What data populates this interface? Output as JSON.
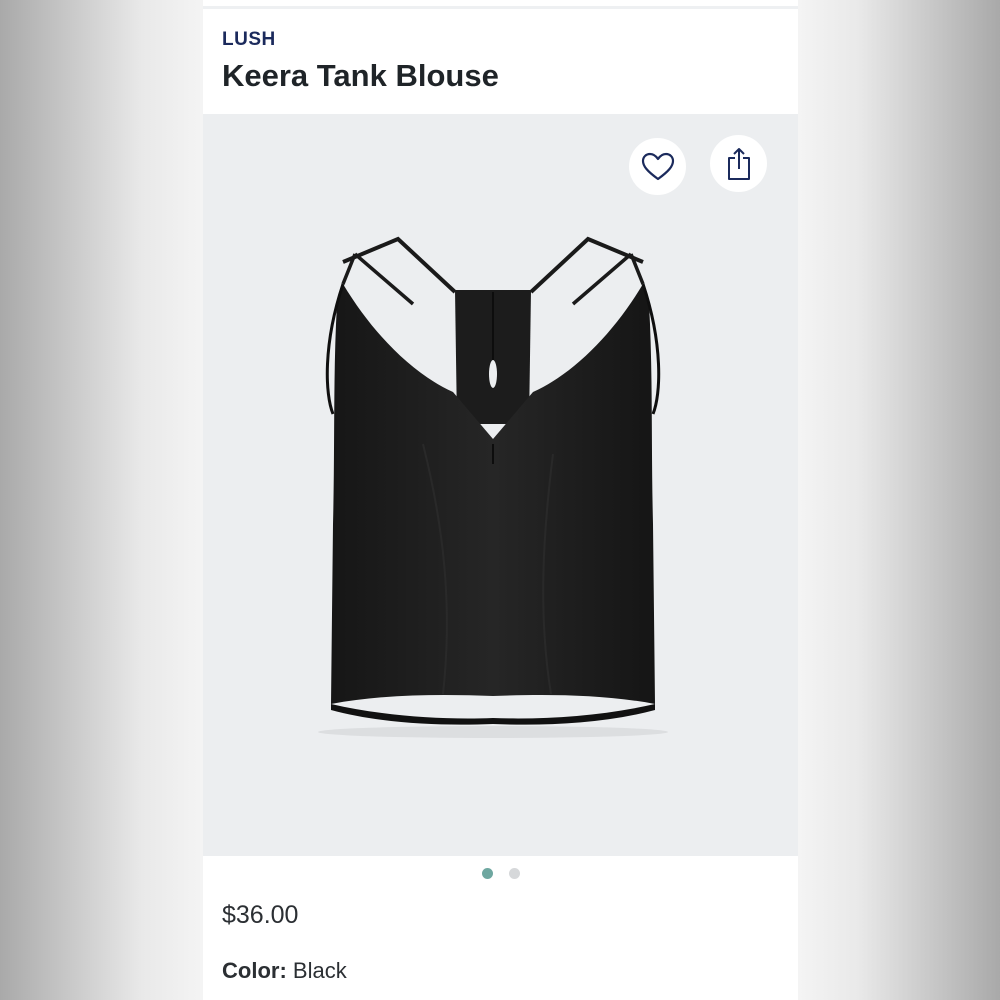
{
  "product": {
    "brand": "LUSH",
    "name": "Keera Tank Blouse",
    "price": "$36.00",
    "color_label": "Color:",
    "color_value": "Black"
  },
  "actions": {
    "favorite_icon": "heart-icon",
    "share_icon": "share-icon"
  },
  "carousel": {
    "total": 2,
    "active_index": 0,
    "active_color": "#6ea7a0",
    "inactive_color": "#d6d8da"
  },
  "colors": {
    "brand_text": "#1b2a5c",
    "photo_bg": "#eceef0",
    "garment": "#1e1e1e"
  }
}
